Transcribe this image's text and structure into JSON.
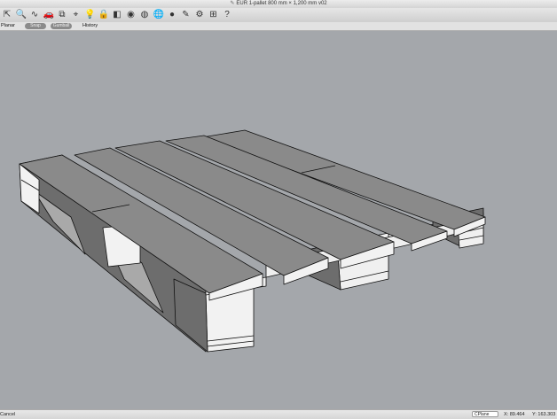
{
  "window": {
    "title": "EUR 1-pallet 800 mm × 1,200 mm v02"
  },
  "toolbar": {
    "icons": [
      {
        "name": "select-icon",
        "glyph": "⇱"
      },
      {
        "name": "zoom-icon",
        "glyph": "🔍"
      },
      {
        "name": "curve-icon",
        "glyph": "∿"
      },
      {
        "name": "render-car-icon",
        "glyph": "🚗"
      },
      {
        "name": "layer-icon",
        "glyph": "⧉"
      },
      {
        "name": "point-edit-icon",
        "glyph": "⌖"
      },
      {
        "name": "bulb-icon",
        "glyph": "💡"
      },
      {
        "name": "lock-icon",
        "glyph": "🔒"
      },
      {
        "name": "shade-icon",
        "glyph": "◧"
      },
      {
        "name": "color-wheel-icon",
        "glyph": "◉"
      },
      {
        "name": "sphere-wire-icon",
        "glyph": "◍"
      },
      {
        "name": "globe-icon",
        "glyph": "🌐"
      },
      {
        "name": "sphere-render-icon",
        "glyph": "●"
      },
      {
        "name": "brush-icon",
        "glyph": "✎"
      },
      {
        "name": "settings-gear-icon",
        "glyph": "⚙"
      },
      {
        "name": "grid-snap-icon",
        "glyph": "⊞"
      },
      {
        "name": "help-icon",
        "glyph": "?"
      }
    ]
  },
  "modebar": {
    "planar": "Planar",
    "pill_1": "Snap",
    "pill_2": "Gumball",
    "history": "History"
  },
  "status": {
    "cancel": "Cancel",
    "cplane": "CPlane",
    "x": "X: 89.464",
    "y": "Y: 163.303"
  },
  "colors": {
    "viewport_bg": "#a4a7ab",
    "top_face": "#8a8a8a",
    "side_face": "#f2f2f2",
    "dark_face": "#6d6d6d",
    "edge": "#111111"
  }
}
